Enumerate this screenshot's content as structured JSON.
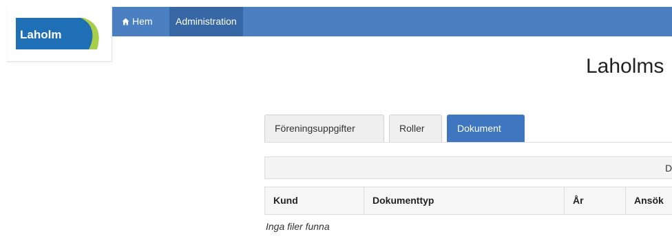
{
  "logo": {
    "text": "Laholm"
  },
  "nav": {
    "home_label": "Hem",
    "admin_label": "Administration"
  },
  "page": {
    "title": "Laholms"
  },
  "tabs": [
    {
      "label": "Föreningsuppgifter"
    },
    {
      "label": "Roller"
    },
    {
      "label": "Dokument"
    }
  ],
  "info_bar": {
    "text": "D"
  },
  "table": {
    "headers": [
      "Kund",
      "Dokumenttyp",
      "År",
      "Ansök"
    ],
    "empty_message": "Inga filer funna"
  },
  "colors": {
    "nav_bg": "#4a7fc2",
    "nav_active": "#3767a5",
    "tab_active": "#3e77c0",
    "logo_blue": "#1f6fb7",
    "logo_green": "#a9cf4a"
  },
  "icons": {
    "home": "home-icon"
  }
}
